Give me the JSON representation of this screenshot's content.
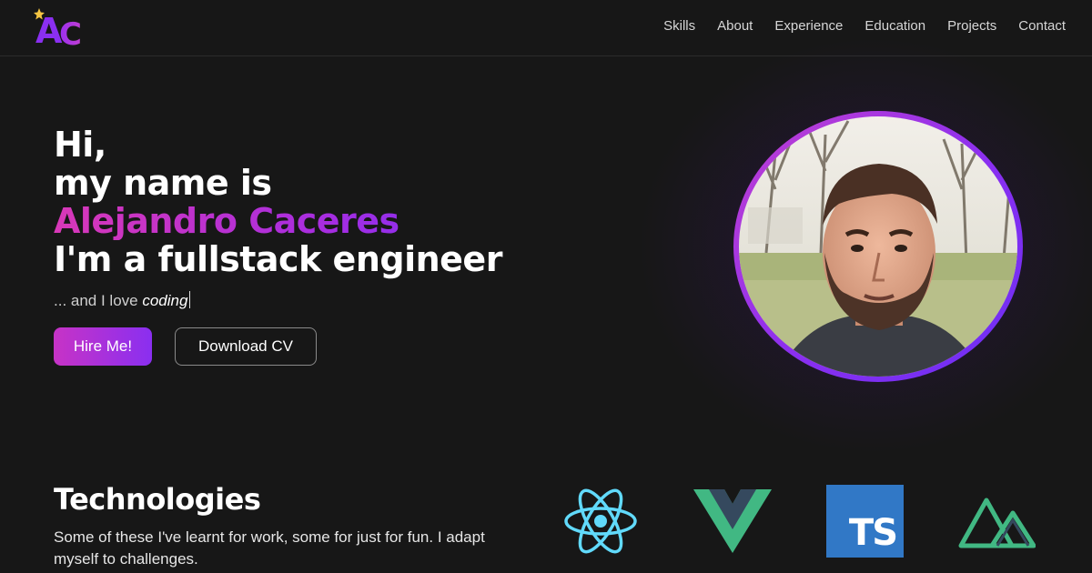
{
  "header": {
    "logo": {
      "letters": "AC",
      "icon": "sparkle-icon",
      "colors": [
        "#8a2ff0",
        "#c23fd0",
        "#f5c542"
      ]
    },
    "nav": [
      {
        "label": "Skills"
      },
      {
        "label": "About"
      },
      {
        "label": "Experience"
      },
      {
        "label": "Education"
      },
      {
        "label": "Projects"
      },
      {
        "label": "Contact"
      }
    ]
  },
  "hero": {
    "line1": "Hi,",
    "line2": "my name is",
    "name": "Alejandro Caceres",
    "line4": "I'm a fullstack engineer",
    "tagline_prefix": "... and I love ",
    "tagline_typed": "coding",
    "hire_label": "Hire Me!",
    "cv_label": "Download CV",
    "accent_gradient": [
      "#d838b8",
      "#7b2ff7"
    ]
  },
  "technologies": {
    "title": "Technologies",
    "description": "Some of these I've learnt for work, some for just for fun. I adapt myself to challenges.",
    "icons": [
      {
        "name": "react-icon",
        "color": "#61dafb"
      },
      {
        "name": "vue-icon",
        "color": "#41b883"
      },
      {
        "name": "typescript-icon",
        "label": "TS",
        "color": "#3178c6"
      },
      {
        "name": "nuxt-icon",
        "color": "#00dc82"
      }
    ]
  }
}
